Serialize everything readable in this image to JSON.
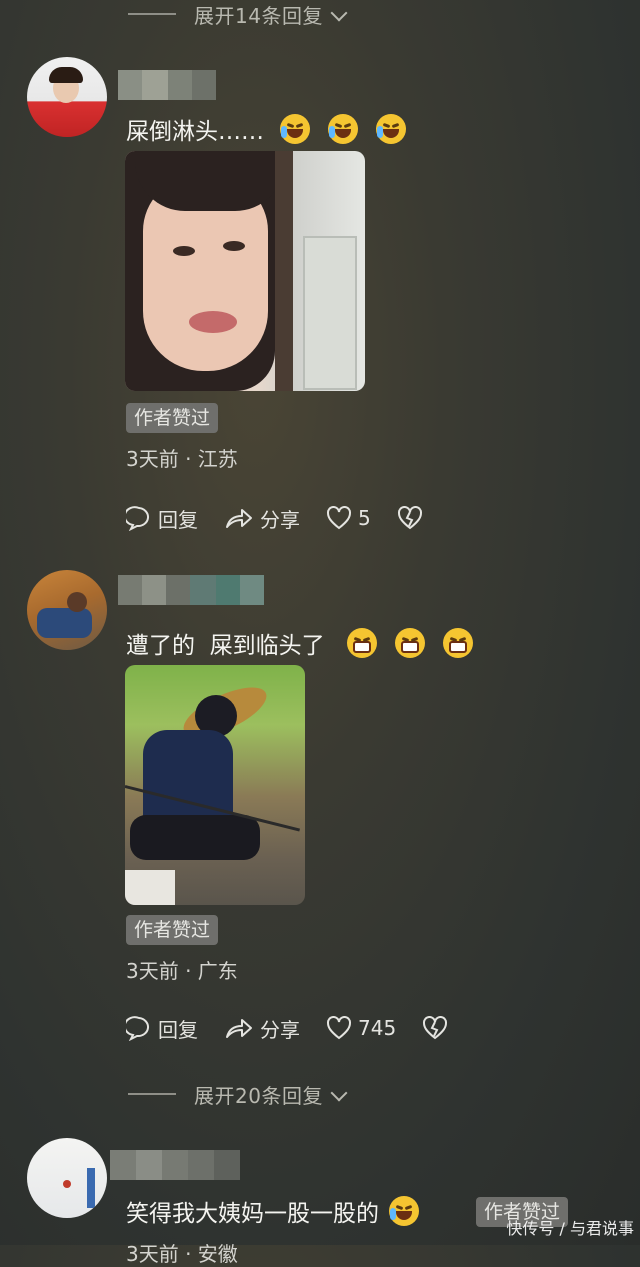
{
  "thread": {
    "expand_top": "展开14条回复",
    "expand_mid": "展开20条回复"
  },
  "comments": [
    {
      "text": "屎倒淋头……",
      "emoji_names": [
        "laugh-cry-emoji",
        "laugh-cry-emoji",
        "laugh-cry-emoji"
      ],
      "badge": "作者赞过",
      "meta": "3天前 · 江苏",
      "reply": "回复",
      "share": "分享",
      "likes": "5"
    },
    {
      "text": "遭了的  屎到临头了",
      "emoji_names": [
        "grimace-emoji",
        "grimace-emoji",
        "grimace-emoji"
      ],
      "badge": "作者赞过",
      "meta": "3天前 · 广东",
      "reply": "回复",
      "share": "分享",
      "likes": "745"
    },
    {
      "text": "笑得我大姨妈一股一股的",
      "emoji_names": [
        "laugh-cry-emoji"
      ],
      "badge": "作者赞过",
      "meta": "3天前 · 安徽"
    }
  ],
  "watermark": "快传号 / 与君说事",
  "colors": {
    "accent_emoji": "#f5c531",
    "badge_bg": "#6f6f6c"
  }
}
